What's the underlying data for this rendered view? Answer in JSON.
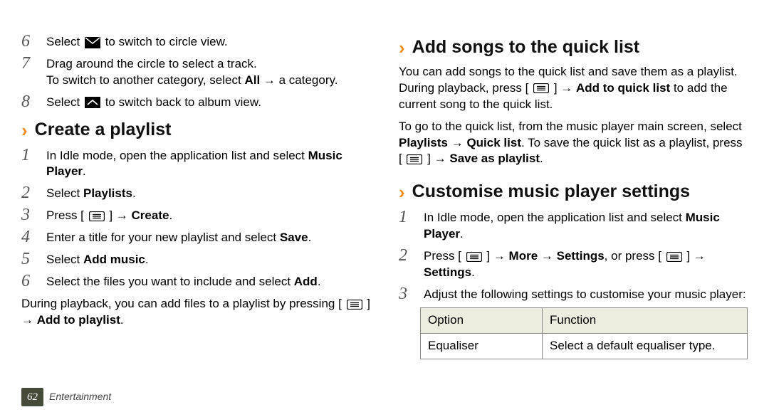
{
  "left": {
    "continued": [
      {
        "num": "6",
        "parts": [
          {
            "t": "Select "
          },
          {
            "icon": "envelope"
          },
          {
            "t": " to switch to circle view."
          }
        ]
      },
      {
        "num": "7",
        "parts": [
          {
            "t": "Drag around the circle to select a track."
          },
          {
            "br": true
          },
          {
            "t": "To switch to another category, select "
          },
          {
            "b": "All"
          },
          {
            "t": " → a category."
          }
        ]
      },
      {
        "num": "8",
        "parts": [
          {
            "t": "Select "
          },
          {
            "icon": "chevup"
          },
          {
            "t": " to switch back to album view."
          }
        ]
      }
    ],
    "create_heading": "Create a playlist",
    "create_steps": [
      {
        "num": "1",
        "parts": [
          {
            "t": "In Idle mode, open the application list and select "
          },
          {
            "b": "Music Player"
          },
          {
            "t": "."
          }
        ]
      },
      {
        "num": "2",
        "parts": [
          {
            "t": "Select "
          },
          {
            "b": "Playlists"
          },
          {
            "t": "."
          }
        ]
      },
      {
        "num": "3",
        "parts": [
          {
            "t": "Press [ "
          },
          {
            "icon": "menu"
          },
          {
            "t": " ] → "
          },
          {
            "b": "Create"
          },
          {
            "t": "."
          }
        ]
      },
      {
        "num": "4",
        "parts": [
          {
            "t": "Enter a title for your new playlist and select "
          },
          {
            "b": "Save"
          },
          {
            "t": "."
          }
        ]
      },
      {
        "num": "5",
        "parts": [
          {
            "t": "Select "
          },
          {
            "b": "Add music"
          },
          {
            "t": "."
          }
        ]
      },
      {
        "num": "6",
        "parts": [
          {
            "t": "Select the files you want to include and select "
          },
          {
            "b": "Add"
          },
          {
            "t": "."
          }
        ]
      }
    ],
    "after_para": [
      {
        "t": "During playback, you can add files to a playlist by pressing [ "
      },
      {
        "icon": "menu"
      },
      {
        "t": " ] → "
      },
      {
        "b": "Add to playlist"
      },
      {
        "t": "."
      }
    ]
  },
  "right": {
    "quick_heading": "Add songs to the quick list",
    "quick_p1": [
      {
        "t": "You can add songs to the quick list and save them as a playlist. During playback, press [ "
      },
      {
        "icon": "menu"
      },
      {
        "t": " ] → "
      },
      {
        "b": "Add to quick list"
      },
      {
        "t": " to add the current song to the quick list."
      }
    ],
    "quick_p2": [
      {
        "t": "To go to the quick list, from the music player main screen, select "
      },
      {
        "b": "Playlists"
      },
      {
        "t": " → "
      },
      {
        "b": "Quick list"
      },
      {
        "t": ". To save the quick list as a playlist, press [ "
      },
      {
        "icon": "menu"
      },
      {
        "t": " ] → "
      },
      {
        "b": "Save as playlist"
      },
      {
        "t": "."
      }
    ],
    "cust_heading": "Customise music player settings",
    "cust_steps": [
      {
        "num": "1",
        "parts": [
          {
            "t": "In Idle mode, open the application list and select "
          },
          {
            "b": "Music Player"
          },
          {
            "t": "."
          }
        ]
      },
      {
        "num": "2",
        "parts": [
          {
            "t": "Press [ "
          },
          {
            "icon": "menu"
          },
          {
            "t": " ] → "
          },
          {
            "b": "More"
          },
          {
            "t": " → "
          },
          {
            "b": "Settings"
          },
          {
            "t": ", or press [ "
          },
          {
            "icon": "menu"
          },
          {
            "t": " ] → "
          },
          {
            "b": "Settings"
          },
          {
            "t": "."
          }
        ]
      },
      {
        "num": "3",
        "parts": [
          {
            "t": "Adjust the following settings to customise your music player:"
          }
        ]
      }
    ],
    "table": {
      "head": [
        "Option",
        "Function"
      ],
      "rows": [
        [
          "Equaliser",
          "Select a default equaliser type."
        ]
      ]
    }
  },
  "footer": {
    "page": "62",
    "section": "Entertainment"
  }
}
